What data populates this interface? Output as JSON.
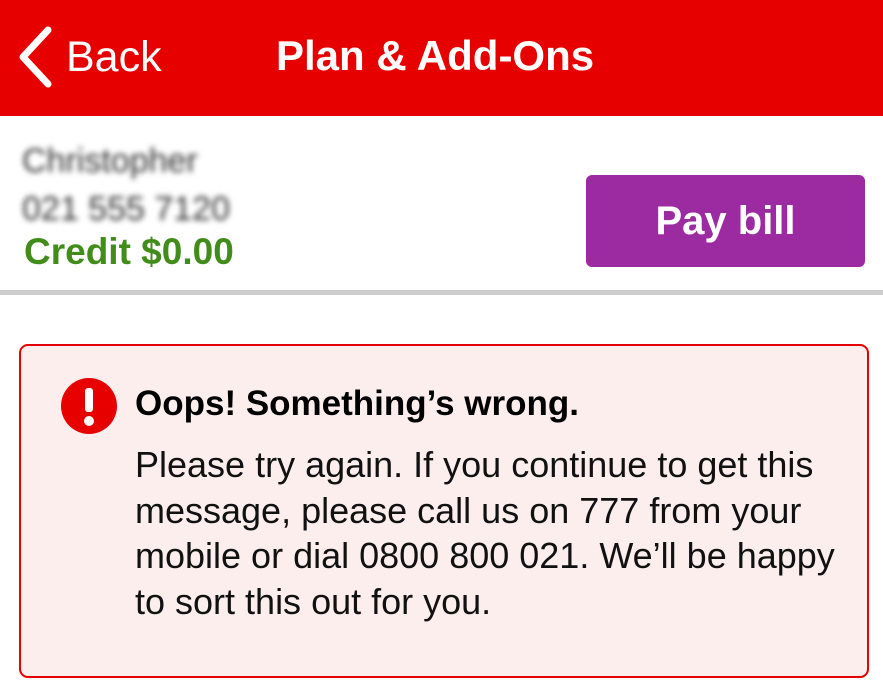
{
  "header": {
    "back_label": "Back",
    "title": "Plan & Add-Ons",
    "background_color": "#e60000"
  },
  "account": {
    "name": "Christopher",
    "number": "021 555 7120",
    "credit": "Credit $0.00",
    "pay_button_label": "Pay bill",
    "credit_color": "#428c1c",
    "pay_button_color": "#9c2aa0"
  },
  "error": {
    "icon": "exclamation-circle-icon",
    "heading": "Oops! Something’s wrong.",
    "message": "Please try again. If you continue to get this message, please call us on 777 from your mobile or dial 0800 800 021. We’ll be happy to sort this out for you.",
    "border_color": "#e60000",
    "background_color": "#fdeeee"
  }
}
